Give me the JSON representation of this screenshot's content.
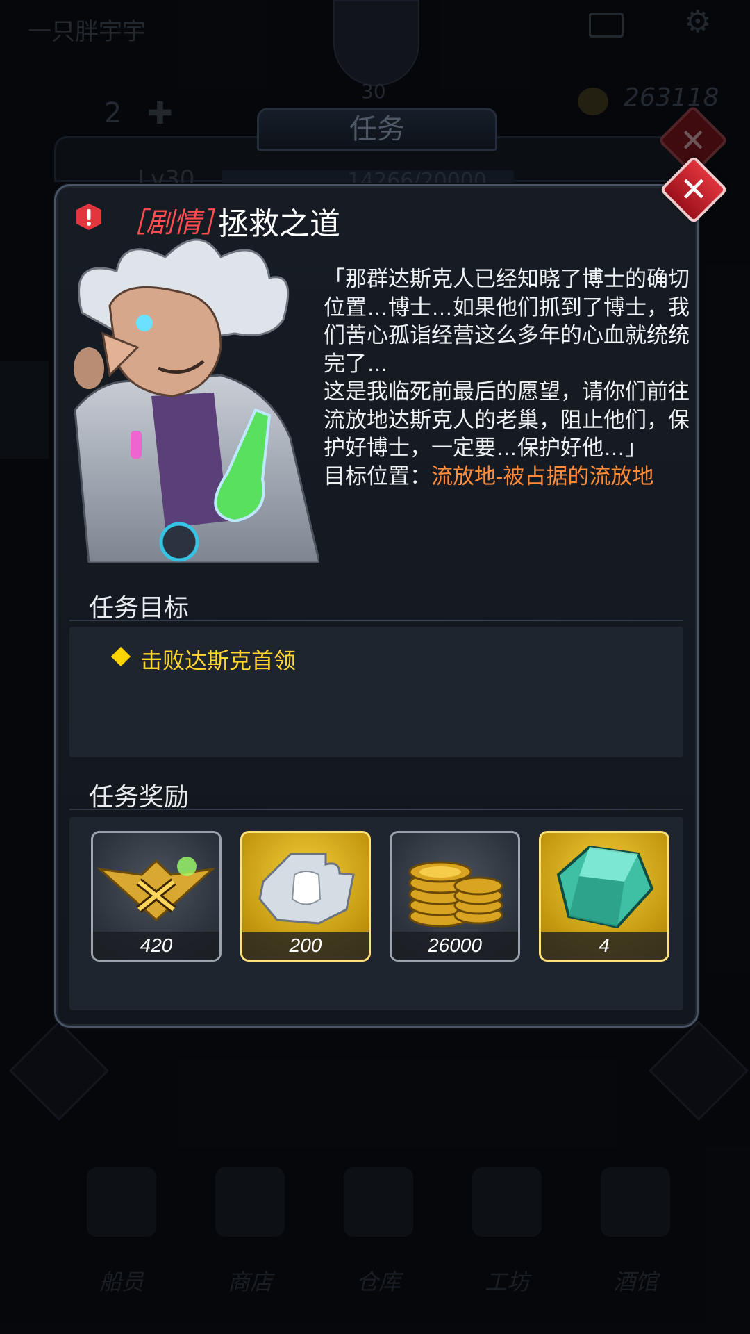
{
  "background": {
    "player_name": "一只胖宇宇",
    "player_level": "30",
    "left_count": "2",
    "coins": "263118",
    "level_label": "Lv30",
    "xp_text": "14266/20000",
    "nav": [
      "船员",
      "商店",
      "仓库",
      "工坊",
      "酒馆"
    ],
    "panel_tab": "任务"
  },
  "dialog": {
    "tag": "［剧情］",
    "title": "拯救之道",
    "description": "「那群达斯克人已经知晓了博士的确切位置…博士…如果他们抓到了博士，我们苦心孤诣经营这么多年的心血就统统完了…\n这是我临死前最后的愿望，请你们前往流放地达斯克人的老巢，阻止他们，保护好博士，一定要…保护好他…」",
    "location_label": "目标位置：",
    "location_value": "流放地-被占据的流放地",
    "objectives_title": "任务目标",
    "objectives": [
      "击败达斯克首领"
    ],
    "rewards_title": "任务奖励",
    "rewards": [
      {
        "icon": "rank-badge-icon",
        "count": "420",
        "style": "grey"
      },
      {
        "icon": "armor-fragment-icon",
        "count": "200",
        "style": "gold"
      },
      {
        "icon": "gold-coins-icon",
        "count": "26000",
        "style": "grey"
      },
      {
        "icon": "crystal-gem-icon",
        "count": "4",
        "style": "gold"
      }
    ]
  },
  "colors": {
    "tag": "#ff4d50",
    "objective": "#ffd52e",
    "location_value": "#ff8c3a",
    "close_button": "#d22a33"
  }
}
